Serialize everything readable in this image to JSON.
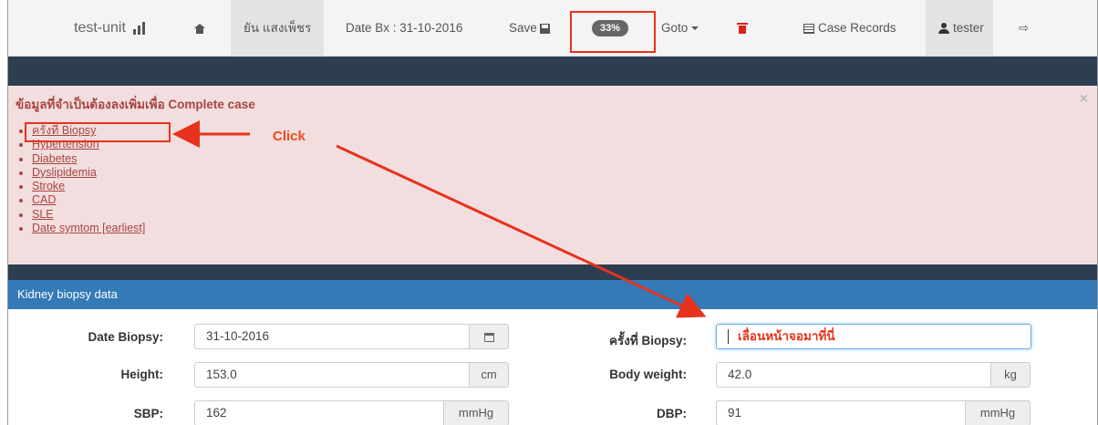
{
  "navbar": {
    "brand": "test-unit",
    "patient_name": "ยัน แสงเพ็ชร",
    "date_bx": "Date Bx : 31-10-2016",
    "save_label": "Save",
    "progress_badge": "33%",
    "goto_label": "Goto",
    "case_records_label": "Case Records",
    "user_label": "tester"
  },
  "alert": {
    "title": "ข้อมูลที่จำเป็นต้องลงเพิ่มเพื่อ Complete case",
    "close": "×",
    "items": [
      "ครั้งที่ Biopsy",
      "Hypertension",
      "Diabetes",
      "Dyslipidemia",
      "Stroke",
      "CAD",
      "SLE",
      "Date symtom [earliest]"
    ]
  },
  "annotation": {
    "click_label": "Click",
    "scroll_hint": "เลื่อนหน้าจอมาที่นี่",
    "color": "#e8321d"
  },
  "panel": {
    "heading": "Kidney biopsy data",
    "fields": {
      "date_biopsy": {
        "label": "Date Biopsy:",
        "value": "31-10-2016"
      },
      "biopsy_no": {
        "label": "ครั้งที่ Biopsy:",
        "value": ""
      },
      "height": {
        "label": "Height:",
        "value": "153.0",
        "unit": "cm"
      },
      "body_weight": {
        "label": "Body weight:",
        "value": "42.0",
        "unit": "kg"
      },
      "sbp": {
        "label": "SBP:",
        "value": "162",
        "unit": "mmHg"
      },
      "dbp": {
        "label": "DBP:",
        "value": "91",
        "unit": "mmHg"
      }
    }
  },
  "colors": {
    "navbar_bg": "#f4f4f4",
    "dark_bar": "#2c3e50",
    "alert_bg": "#f2dede",
    "alert_text": "#a94442",
    "panel_heading": "#337ab7",
    "trash": "#d9231e"
  },
  "icons": [
    "bar-chart-icon",
    "home-icon",
    "save-icon",
    "caret-down-icon",
    "trash-icon",
    "list-icon",
    "user-icon",
    "sign-out-icon",
    "calendar-icon",
    "close-icon"
  ]
}
